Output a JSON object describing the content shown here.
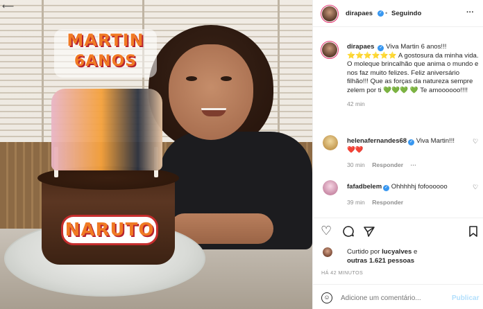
{
  "post": {
    "author": "dirapaes",
    "follow_state": "Seguindo",
    "more_label": "···",
    "caption_text": "Viva Martin 6 anos!!!",
    "caption_stars": "⭐⭐⭐⭐⭐⭐",
    "caption_text_2": "A gostosura da minha vida. O moleque brincalhão que anima o mundo e nos faz muito felizes. Feliz aniversário filhão!!! Que as forças da natureza sempre zelem por ti",
    "caption_hearts": "💚💚💚",
    "caption_heart_4": "💚",
    "caption_text_3": "Te amoooooo!!!!",
    "caption_time": "42 min"
  },
  "photo": {
    "topper_line1": "MARTIN",
    "topper_line2": "6ANOS",
    "cake_label": "NARUTO"
  },
  "comments": [
    {
      "user": "helenafernandes68",
      "text": "Viva Martin!!!",
      "hearts": "❤️❤️",
      "time": "30 min",
      "reply_label": "Responder",
      "more": "···",
      "avatar_color": "#d8b56a"
    },
    {
      "user": "fafadbelem",
      "text": "Ohhhhhj fofoooooo",
      "time": "39 min",
      "reply_label": "Responder",
      "avatar_color": "#e8a9c4"
    }
  ],
  "actions": {
    "like_icon": "heart-outline-icon",
    "comment_icon": "comment-icon",
    "share_icon": "send-icon",
    "save_icon": "bookmark-icon"
  },
  "likes": {
    "prefix": "Curtido por",
    "first_user": "lucyalves",
    "conjunction": "e",
    "others": "outras 1.621 pessoas"
  },
  "time_ago": "HÁ 42 MINUTOS",
  "comment_box": {
    "placeholder": "Adicione um comentário...",
    "publish_label": "Publicar"
  },
  "colors": {
    "accent": "#0095f6",
    "publish_disabled": "#b2dffc",
    "verified": "#3897f0",
    "story_ring": "#e1306c"
  }
}
